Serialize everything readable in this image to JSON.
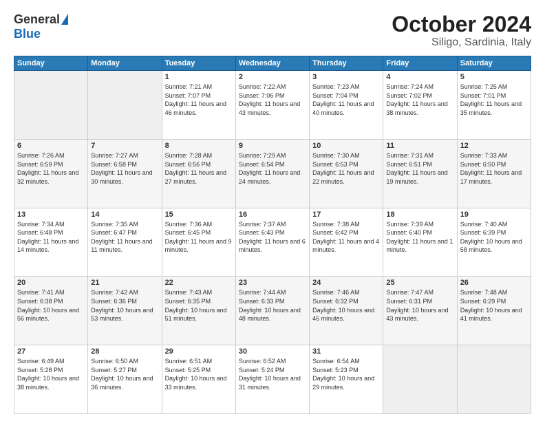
{
  "header": {
    "logo_general": "General",
    "logo_blue": "Blue",
    "month": "October 2024",
    "location": "Siligo, Sardinia, Italy"
  },
  "days_of_week": [
    "Sunday",
    "Monday",
    "Tuesday",
    "Wednesday",
    "Thursday",
    "Friday",
    "Saturday"
  ],
  "weeks": [
    [
      {
        "day": "",
        "info": ""
      },
      {
        "day": "",
        "info": ""
      },
      {
        "day": "1",
        "info": "Sunrise: 7:21 AM\nSunset: 7:07 PM\nDaylight: 11 hours and 46 minutes."
      },
      {
        "day": "2",
        "info": "Sunrise: 7:22 AM\nSunset: 7:06 PM\nDaylight: 11 hours and 43 minutes."
      },
      {
        "day": "3",
        "info": "Sunrise: 7:23 AM\nSunset: 7:04 PM\nDaylight: 11 hours and 40 minutes."
      },
      {
        "day": "4",
        "info": "Sunrise: 7:24 AM\nSunset: 7:02 PM\nDaylight: 11 hours and 38 minutes."
      },
      {
        "day": "5",
        "info": "Sunrise: 7:25 AM\nSunset: 7:01 PM\nDaylight: 11 hours and 35 minutes."
      }
    ],
    [
      {
        "day": "6",
        "info": "Sunrise: 7:26 AM\nSunset: 6:59 PM\nDaylight: 11 hours and 32 minutes."
      },
      {
        "day": "7",
        "info": "Sunrise: 7:27 AM\nSunset: 6:58 PM\nDaylight: 11 hours and 30 minutes."
      },
      {
        "day": "8",
        "info": "Sunrise: 7:28 AM\nSunset: 6:56 PM\nDaylight: 11 hours and 27 minutes."
      },
      {
        "day": "9",
        "info": "Sunrise: 7:29 AM\nSunset: 6:54 PM\nDaylight: 11 hours and 24 minutes."
      },
      {
        "day": "10",
        "info": "Sunrise: 7:30 AM\nSunset: 6:53 PM\nDaylight: 11 hours and 22 minutes."
      },
      {
        "day": "11",
        "info": "Sunrise: 7:31 AM\nSunset: 6:51 PM\nDaylight: 11 hours and 19 minutes."
      },
      {
        "day": "12",
        "info": "Sunrise: 7:33 AM\nSunset: 6:50 PM\nDaylight: 11 hours and 17 minutes."
      }
    ],
    [
      {
        "day": "13",
        "info": "Sunrise: 7:34 AM\nSunset: 6:48 PM\nDaylight: 11 hours and 14 minutes."
      },
      {
        "day": "14",
        "info": "Sunrise: 7:35 AM\nSunset: 6:47 PM\nDaylight: 11 hours and 11 minutes."
      },
      {
        "day": "15",
        "info": "Sunrise: 7:36 AM\nSunset: 6:45 PM\nDaylight: 11 hours and 9 minutes."
      },
      {
        "day": "16",
        "info": "Sunrise: 7:37 AM\nSunset: 6:43 PM\nDaylight: 11 hours and 6 minutes."
      },
      {
        "day": "17",
        "info": "Sunrise: 7:38 AM\nSunset: 6:42 PM\nDaylight: 11 hours and 4 minutes."
      },
      {
        "day": "18",
        "info": "Sunrise: 7:39 AM\nSunset: 6:40 PM\nDaylight: 11 hours and 1 minute."
      },
      {
        "day": "19",
        "info": "Sunrise: 7:40 AM\nSunset: 6:39 PM\nDaylight: 10 hours and 58 minutes."
      }
    ],
    [
      {
        "day": "20",
        "info": "Sunrise: 7:41 AM\nSunset: 6:38 PM\nDaylight: 10 hours and 56 minutes."
      },
      {
        "day": "21",
        "info": "Sunrise: 7:42 AM\nSunset: 6:36 PM\nDaylight: 10 hours and 53 minutes."
      },
      {
        "day": "22",
        "info": "Sunrise: 7:43 AM\nSunset: 6:35 PM\nDaylight: 10 hours and 51 minutes."
      },
      {
        "day": "23",
        "info": "Sunrise: 7:44 AM\nSunset: 6:33 PM\nDaylight: 10 hours and 48 minutes."
      },
      {
        "day": "24",
        "info": "Sunrise: 7:46 AM\nSunset: 6:32 PM\nDaylight: 10 hours and 46 minutes."
      },
      {
        "day": "25",
        "info": "Sunrise: 7:47 AM\nSunset: 6:31 PM\nDaylight: 10 hours and 43 minutes."
      },
      {
        "day": "26",
        "info": "Sunrise: 7:48 AM\nSunset: 6:29 PM\nDaylight: 10 hours and 41 minutes."
      }
    ],
    [
      {
        "day": "27",
        "info": "Sunrise: 6:49 AM\nSunset: 5:28 PM\nDaylight: 10 hours and 38 minutes."
      },
      {
        "day": "28",
        "info": "Sunrise: 6:50 AM\nSunset: 5:27 PM\nDaylight: 10 hours and 36 minutes."
      },
      {
        "day": "29",
        "info": "Sunrise: 6:51 AM\nSunset: 5:25 PM\nDaylight: 10 hours and 33 minutes."
      },
      {
        "day": "30",
        "info": "Sunrise: 6:52 AM\nSunset: 5:24 PM\nDaylight: 10 hours and 31 minutes."
      },
      {
        "day": "31",
        "info": "Sunrise: 6:54 AM\nSunset: 5:23 PM\nDaylight: 10 hours and 29 minutes."
      },
      {
        "day": "",
        "info": ""
      },
      {
        "day": "",
        "info": ""
      }
    ]
  ]
}
